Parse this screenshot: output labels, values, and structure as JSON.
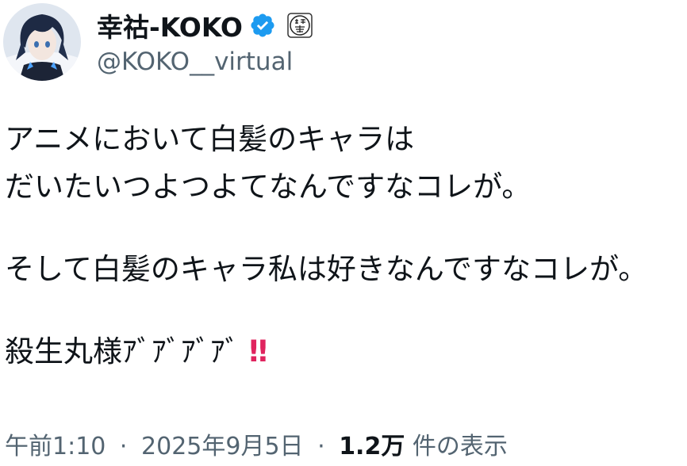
{
  "author": {
    "display_name": "幸祜-KOKO",
    "handle": "@KOKO__virtual",
    "verified_icon": "verified-badge-icon",
    "affiliate_icon": "affiliate-seal-icon"
  },
  "tweet": {
    "lines": [
      "アニメにおいて白髪のキャラは",
      "だいたいつよつよてなんですなコレが。",
      "",
      "そして白髪のキャラ私は好きなんですなコレが。",
      "",
      "殺生丸様ｱﾞｱﾞｱﾞｱﾞ"
    ],
    "emoji": "‼"
  },
  "meta": {
    "time": "午前1:10",
    "date": "2025年9月5日",
    "separator": "·",
    "views_count": "1.2万",
    "views_label": "件の表示"
  },
  "colors": {
    "text_primary": "#0f1419",
    "text_secondary": "#536471",
    "verified_blue": "#1d9bf0",
    "emoji_red": "#e0245e"
  }
}
